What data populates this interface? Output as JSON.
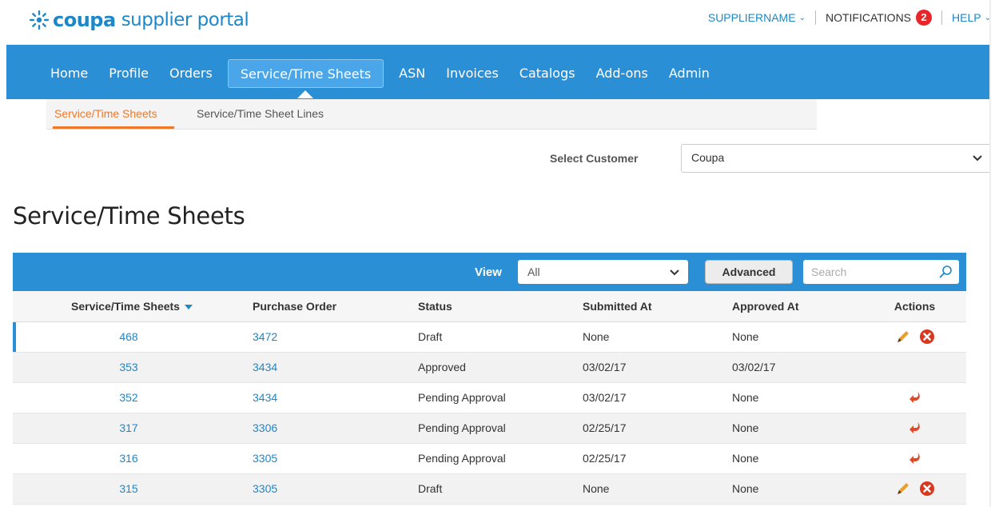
{
  "header": {
    "brand": "coupa",
    "brand_rest": "supplier portal",
    "user_label": "SUPPLIERNAME",
    "notifications_label": "NOTIFICATIONS",
    "notifications_count": "2",
    "help_label": "HELP"
  },
  "nav": {
    "tabs": [
      {
        "label": "Home"
      },
      {
        "label": "Profile"
      },
      {
        "label": "Orders"
      },
      {
        "label": "Service/Time Sheets",
        "active": true
      },
      {
        "label": "ASN"
      },
      {
        "label": "Invoices"
      },
      {
        "label": "Catalogs"
      },
      {
        "label": "Add-ons"
      },
      {
        "label": "Admin"
      }
    ]
  },
  "subnav": {
    "tabs": [
      {
        "label": "Service/Time Sheets",
        "active": true
      },
      {
        "label": "Service/Time Sheet Lines"
      }
    ]
  },
  "customer": {
    "label": "Select Customer",
    "value": "Coupa"
  },
  "page": {
    "title": "Service/Time Sheets"
  },
  "toolbar": {
    "view_label": "View",
    "view_value": "All",
    "advanced_label": "Advanced",
    "search_placeholder": "Search"
  },
  "table": {
    "columns": [
      "Service/Time Sheets",
      "Purchase Order",
      "Status",
      "Submitted At",
      "Approved At",
      "Actions"
    ],
    "rows": [
      {
        "id": "468",
        "po": "3472",
        "status": "Draft",
        "submitted": "None",
        "approved": "None",
        "actions": [
          "edit-icon",
          "delete-icon"
        ]
      },
      {
        "id": "353",
        "po": "3434",
        "status": "Approved",
        "submitted": "03/02/17",
        "approved": "03/02/17",
        "actions": []
      },
      {
        "id": "352",
        "po": "3434",
        "status": "Pending Approval",
        "submitted": "03/02/17",
        "approved": "None",
        "actions": [
          "withdraw-icon"
        ]
      },
      {
        "id": "317",
        "po": "3306",
        "status": "Pending Approval",
        "submitted": "02/25/17",
        "approved": "None",
        "actions": [
          "withdraw-icon"
        ]
      },
      {
        "id": "316",
        "po": "3305",
        "status": "Pending Approval",
        "submitted": "02/25/17",
        "approved": "None",
        "actions": [
          "withdraw-icon"
        ]
      },
      {
        "id": "315",
        "po": "3305",
        "status": "Draft",
        "submitted": "None",
        "approved": "None",
        "actions": [
          "edit-icon",
          "delete-icon"
        ]
      }
    ]
  },
  "colors": {
    "brand_blue": "#1e87c8",
    "nav_blue": "#2b8fd6",
    "active_orange": "#f0782a",
    "badge_red": "#e8262a"
  }
}
